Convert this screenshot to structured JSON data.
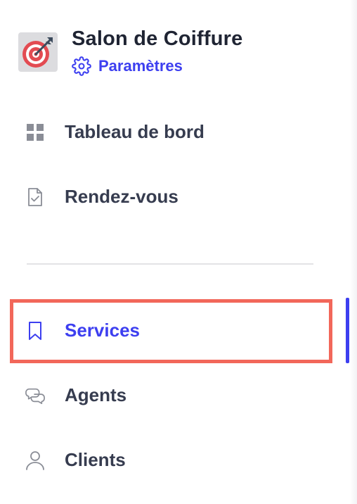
{
  "app": {
    "title": "Salon de Coiffure",
    "settings_label": "Paramètres",
    "logo_icon": "target-dart-icon"
  },
  "nav": {
    "items": [
      {
        "label": "Tableau de bord",
        "icon": "grid-icon",
        "active": false
      },
      {
        "label": "Rendez-vous",
        "icon": "checked-document-icon",
        "active": false
      },
      {
        "label": "Services",
        "icon": "bookmark-icon",
        "active": true
      },
      {
        "label": "Agents",
        "icon": "chat-bubbles-icon",
        "active": false
      },
      {
        "label": "Clients",
        "icon": "user-icon",
        "active": false
      }
    ]
  },
  "colors": {
    "accent": "#3d3ff0",
    "highlight_border": "#f2675a",
    "text_dark": "#1f2433",
    "nav_text": "#363c4f",
    "icon_gray": "#8a8d96"
  }
}
